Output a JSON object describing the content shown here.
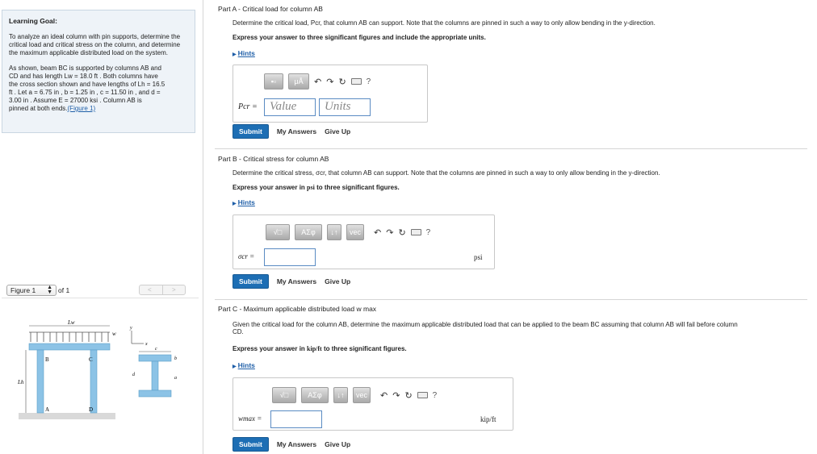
{
  "learning_goal": {
    "title": "Learning Goal:",
    "text": "To analyze an ideal column with pin supports, determine the critical load and critical stress on the column, and determine the maximum applicable distributed load on the system.",
    "problem_lines": [
      "As shown, beam BC is supported by columns AB and",
      "CD and has length Lw = 18.0 ft . Both columns have",
      "the cross section shown and have lengths of Lh = 16.5",
      "ft . Let a = 6.75 in , b = 1.25 in , c = 11.50 in , and d =",
      "3.00 in . Assume E = 27000 ksi . Column AB is",
      "pinned at both ends."
    ],
    "figure_link": "(Figure 1)"
  },
  "figure_nav": {
    "select": "Figure 1",
    "of": "of 1",
    "prev": "<",
    "next": ">"
  },
  "figure_labels": {
    "Lw": "Lw",
    "w": "w",
    "B": "B",
    "C": "C",
    "A": "A",
    "D": "D",
    "Lh": "Lh",
    "y": "y",
    "x": "x",
    "c": "c",
    "b": "b",
    "d": "d",
    "a": "a"
  },
  "toolbar_icons": [
    "templates-icon",
    "unit-mu-angstrom-icon",
    "undo-icon",
    "redo-icon",
    "reset-icon",
    "keyboard-icon",
    "help-icon"
  ],
  "part_a": {
    "title": "Part A",
    "title_rest": " - Critical load for column AB",
    "desc": "Determine the critical load, Pcr, that column AB can support. Note that the columns are pinned in such a way to only allow bending in the y-direction.",
    "express": "Express your answer to three significant figures and include the appropriate units.",
    "hints": "Hints",
    "tb_units": "μÅ",
    "label": "Pcr =",
    "value_placeholder": "Value",
    "units_placeholder": "Units",
    "submit": "Submit",
    "my_answers": "My Answers",
    "give_up": "Give Up",
    "help": "?"
  },
  "part_b": {
    "title": "Part B",
    "title_rest": " - Critical stress for column AB",
    "desc": "Determine the critical stress, σcr, that column AB can support. Note that the columns are pinned in such a way to only allow bending in the y-direction.",
    "express_pre": "Express your answer in ",
    "express_unit": "psi",
    "express_post": " to three significant figures.",
    "hints": "Hints",
    "tb_sqrt": "√□",
    "tb_greek": "ΑΣφ",
    "tb_arrows": "↓↑",
    "tb_vec": "vec",
    "label": "σcr =",
    "unit": "psi",
    "submit": "Submit",
    "my_answers": "My Answers",
    "give_up": "Give Up",
    "help": "?"
  },
  "part_c": {
    "title": "Part C",
    "title_rest": " - Maximum applicable distributed load w max",
    "desc": "Given the critical load for the column AB, determine the maximum applicable distributed load that can be applied to the beam BC assuming that column AB will fail before column",
    "desc2": "CD.",
    "express_pre": "Express your answer in ",
    "express_unit": "kip/ft",
    "express_post": " to three significant figures.",
    "hints": "Hints",
    "tb_sqrt": "√□",
    "tb_greek": "ΑΣφ",
    "tb_arrows": "↓↑",
    "tb_vec": "vec",
    "label": "wmax =",
    "unit": "kip/ft",
    "submit": "Submit",
    "my_answers": "My Answers",
    "give_up": "Give Up",
    "help": "?"
  },
  "colors": {
    "accent": "#1d6eb4",
    "link": "#1f5fa8",
    "goal_bg": "#eef3f8",
    "steel": "#8cc3e6"
  }
}
